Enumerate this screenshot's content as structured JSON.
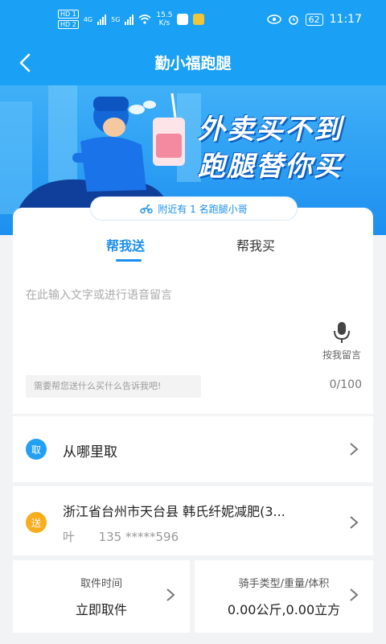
{
  "status_bar": {
    "hd1": "HD 1",
    "hd2": "HD 2",
    "sig1": "4G",
    "sig2": "5G",
    "net_speed": "15.5",
    "net_unit": "K/s",
    "battery": "62",
    "time": "11:17"
  },
  "header": {
    "title": "勤小福跑腿"
  },
  "banner": {
    "slogan_line1": "外卖买不到",
    "slogan_line2": "跑腿替你买",
    "nearby_text": "附近有 1 名跑腿小哥"
  },
  "tabs": [
    {
      "label": "帮我送",
      "active": true
    },
    {
      "label": "帮我买",
      "active": false
    }
  ],
  "message": {
    "placeholder": "在此输入文字或进行语音留言",
    "voice_label": "按我留言",
    "hint": "需要帮您送什么买什么告诉我吧!",
    "count": "0/100"
  },
  "pickup": {
    "badge": "取",
    "label": "从哪里取"
  },
  "delivery": {
    "badge": "送",
    "address": "浙江省台州市天台县 韩氏纤妮减肥(3...",
    "contact_name": "叶",
    "contact_phone": "135 *****596"
  },
  "pickup_time": {
    "label": "取件时间",
    "value": "立即取件"
  },
  "rider_type": {
    "label": "骑手类型/重量/体积",
    "value": "0.00公斤,0.00立方"
  },
  "colors": {
    "brand_blue": "#1aa1f5",
    "accent_blue": "#1a8ef0",
    "pickup_badge": "#22a0f4",
    "deliver_badge": "#f6ae1f"
  }
}
